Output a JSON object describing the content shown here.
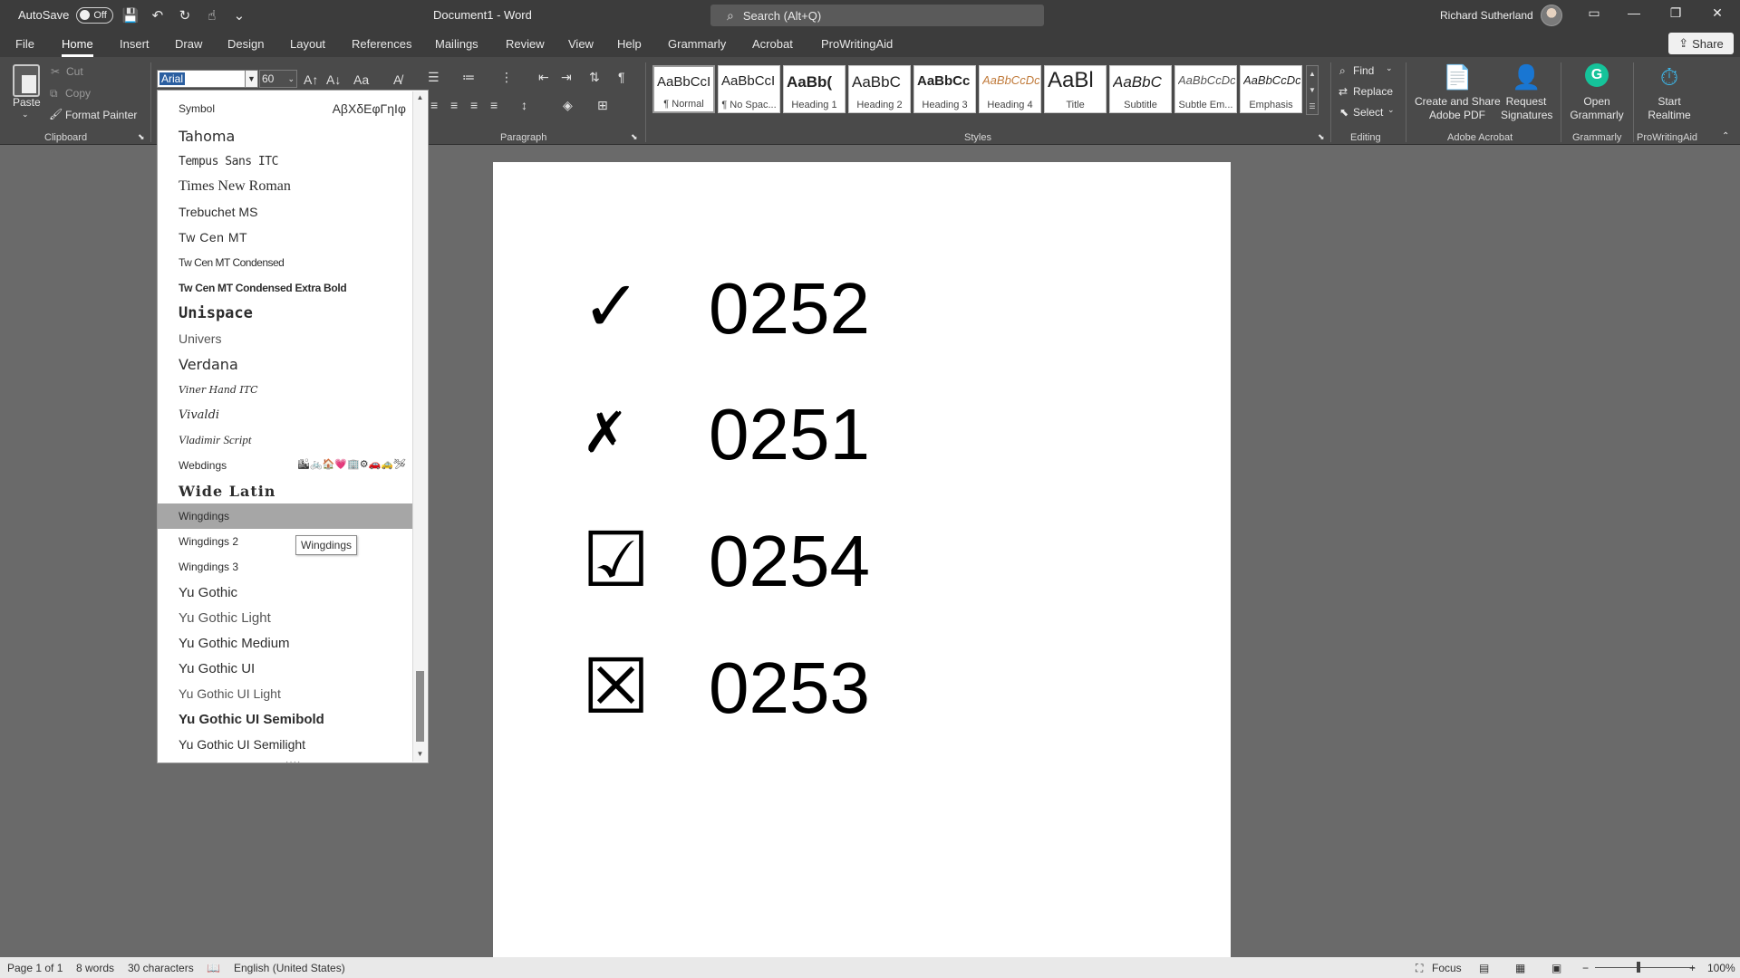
{
  "titlebar": {
    "autosave_label": "AutoSave",
    "autosave_state": "Off",
    "doc_title": "Document1  -  Word",
    "search_placeholder": "Search (Alt+Q)",
    "user_name": "Richard Sutherland"
  },
  "tabs": [
    "File",
    "Home",
    "Insert",
    "Draw",
    "Design",
    "Layout",
    "References",
    "Mailings",
    "Review",
    "View",
    "Help",
    "Grammarly",
    "Acrobat",
    "ProWritingAid"
  ],
  "active_tab": "Home",
  "share_label": "Share",
  "ribbon": {
    "clipboard": {
      "paste": "Paste",
      "cut": "Cut",
      "copy": "Copy",
      "format_painter": "Format Painter",
      "label": "Clipboard"
    },
    "font": {
      "name": "Arial",
      "size": "60"
    },
    "paragraph_label": "Paragraph",
    "styles_label": "Styles",
    "styles": [
      {
        "sample": "AaBbCcI",
        "name": "¶ Normal"
      },
      {
        "sample": "AaBbCcI",
        "name": "¶ No Spac..."
      },
      {
        "sample": "AaBb(",
        "name": "Heading 1"
      },
      {
        "sample": "AaBbC",
        "name": "Heading 2"
      },
      {
        "sample": "AaBbCc",
        "name": "Heading 3"
      },
      {
        "sample": "AaBbCcDc",
        "name": "Heading 4"
      },
      {
        "sample": "AaBl",
        "name": "Title"
      },
      {
        "sample": "AaBbC",
        "name": "Subtitle"
      },
      {
        "sample": "AaBbCcDc",
        "name": "Subtle Em..."
      },
      {
        "sample": "AaBbCcDc",
        "name": "Emphasis"
      }
    ],
    "editing": {
      "find": "Find",
      "replace": "Replace",
      "select": "Select",
      "label": "Editing"
    },
    "acrobat": {
      "create_share": "Create and Share\nAdobe PDF",
      "request_sig": "Request\nSignatures",
      "label": "Adobe Acrobat"
    },
    "grammarly": {
      "open": "Open\nGrammarly",
      "label": "Grammarly"
    },
    "prowritingaid": {
      "start": "Start\nRealtime",
      "label": "ProWritingAid"
    }
  },
  "font_list": [
    {
      "name": "Symbol",
      "preview": "ΑβΧδΕφΓηΙφ"
    },
    {
      "name": "Tahoma"
    },
    {
      "name": "Tempus Sans ITC"
    },
    {
      "name": "Times New Roman"
    },
    {
      "name": "Trebuchet MS"
    },
    {
      "name": "Tw Cen MT"
    },
    {
      "name": "Tw Cen MT Condensed"
    },
    {
      "name": "Tw Cen MT Condensed Extra Bold"
    },
    {
      "name": "Unispace"
    },
    {
      "name": "Univers"
    },
    {
      "name": "Verdana"
    },
    {
      "name": "Viner Hand ITC"
    },
    {
      "name": "Vivaldi"
    },
    {
      "name": "Vladimir Script"
    },
    {
      "name": "Webdings",
      "preview": "🏙🚲🏠💗🏢⚙🚗🚕🛩"
    },
    {
      "name": "Wide Latin"
    },
    {
      "name": "Wingdings"
    },
    {
      "name": "Wingdings 2"
    },
    {
      "name": "Wingdings 3"
    },
    {
      "name": "Yu Gothic"
    },
    {
      "name": "Yu Gothic Light"
    },
    {
      "name": "Yu Gothic Medium"
    },
    {
      "name": "Yu Gothic UI"
    },
    {
      "name": "Yu Gothic UI Light"
    },
    {
      "name": "Yu Gothic UI Semibold"
    },
    {
      "name": "Yu Gothic UI Semilight"
    }
  ],
  "highlighted_font": "Wingdings",
  "tooltip": "Wingdings",
  "document": {
    "rows": [
      {
        "symbol": "✓",
        "code": "0252"
      },
      {
        "symbol": "✗",
        "code": "0251"
      },
      {
        "symbol": "☑",
        "code": "0254"
      },
      {
        "symbol": "☒",
        "code": "0253"
      }
    ]
  },
  "status": {
    "page": "Page 1 of 1",
    "words": "8 words",
    "characters": "30 characters",
    "language": "English (United States)",
    "focus": "Focus",
    "zoom": "100%"
  }
}
